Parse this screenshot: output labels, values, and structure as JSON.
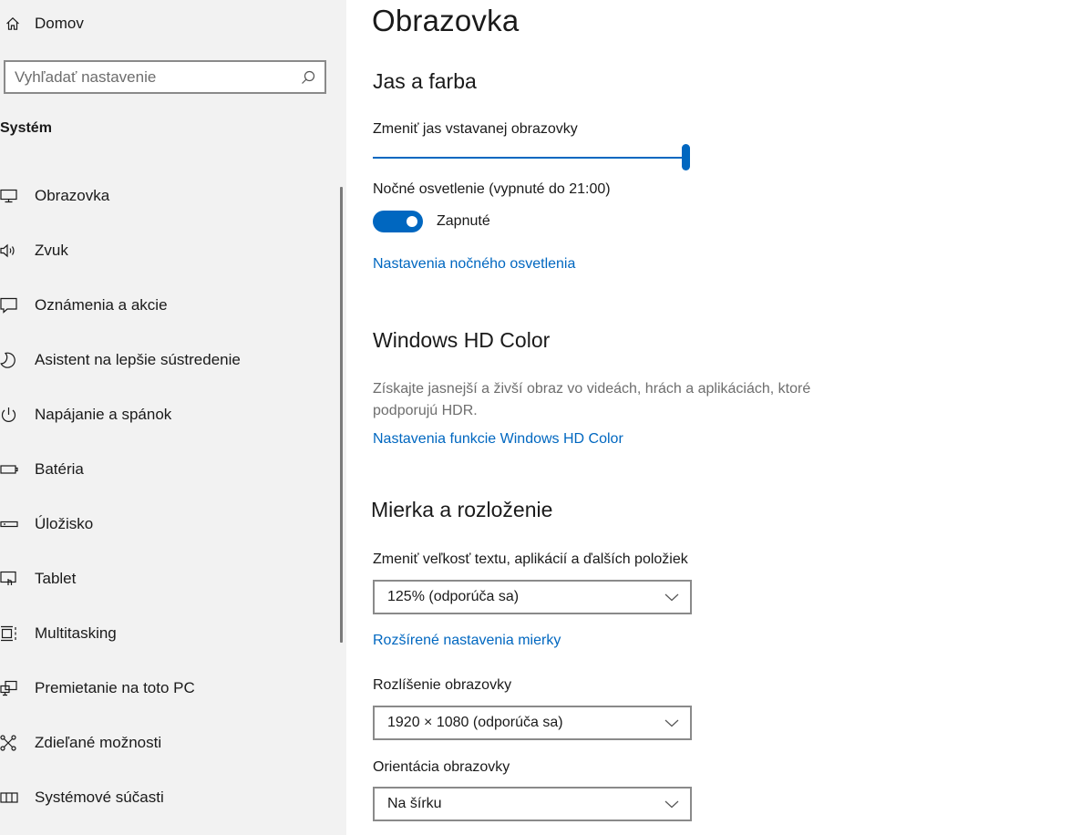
{
  "sidebar": {
    "home_label": "Domov",
    "search_placeholder": "Vyhľadať nastavenie",
    "section_title": "Systém",
    "items": [
      {
        "label": "Obrazovka",
        "icon": "monitor-icon"
      },
      {
        "label": "Zvuk",
        "icon": "speaker-icon"
      },
      {
        "label": "Oznámenia a akcie",
        "icon": "notification-icon"
      },
      {
        "label": "Asistent na lepšie sústredenie",
        "icon": "moon-icon"
      },
      {
        "label": "Napájanie a spánok",
        "icon": "power-icon"
      },
      {
        "label": "Batéria",
        "icon": "battery-icon"
      },
      {
        "label": "Úložisko",
        "icon": "storage-icon"
      },
      {
        "label": "Tablet",
        "icon": "tablet-icon"
      },
      {
        "label": "Multitasking",
        "icon": "multitasking-icon"
      },
      {
        "label": "Premietanie na toto PC",
        "icon": "projecting-icon"
      },
      {
        "label": "Zdieľané možnosti",
        "icon": "shared-experiences-icon"
      },
      {
        "label": "Systémové súčasti",
        "icon": "system-components-icon"
      }
    ]
  },
  "main": {
    "title": "Obrazovka",
    "brightness": {
      "heading": "Jas a farba",
      "slider_label": "Zmeniť jas vstavanej obrazovky",
      "slider_value": 1.0,
      "night_light_label": "Nočné osvetlenie (vypnuté do 21:00)",
      "toggle_state": "Zapnuté",
      "night_light_link": "Nastavenia nočného osvetlenia"
    },
    "hdr": {
      "heading": "Windows HD Color",
      "description_line1": "Získajte jasnejší a živší obraz vo videách, hrách a aplikáciách, ktoré",
      "description_line2": "podporujú HDR.",
      "link": "Nastavenia funkcie Windows HD Color"
    },
    "scale": {
      "heading": "Mierka a rozloženie",
      "scale_label": "Zmeniť veľkosť textu, aplikácií a ďalších položiek",
      "scale_value": "125% (odporúča sa)",
      "advanced_link": "Rozšírené nastavenia mierky",
      "resolution_label": "Rozlíšenie obrazovky",
      "resolution_value": "1920 × 1080 (odporúča sa)",
      "orientation_label": "Orientácia obrazovky",
      "orientation_value": "Na šírku"
    }
  },
  "colors": {
    "accent": "#0067c0",
    "sidebar_bg": "#f2f2f2"
  }
}
